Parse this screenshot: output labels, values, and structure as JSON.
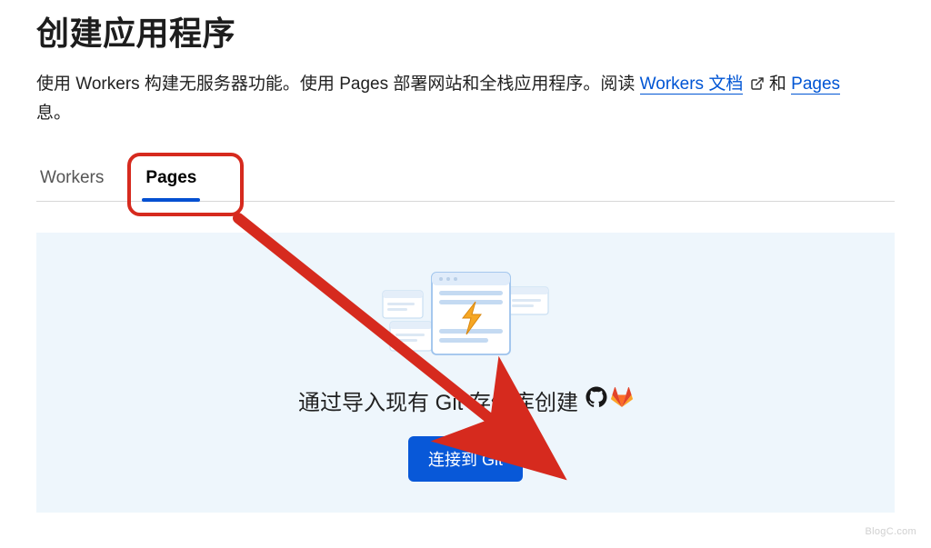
{
  "title": "创建应用程序",
  "description": {
    "part1": "使用 Workers 构建无服务器功能。使用 Pages 部署网站和全栈应用程序。阅读 ",
    "link1": "Workers 文档",
    "mid": " 和 ",
    "link2": "Pages",
    "part2": "息。"
  },
  "tabs": {
    "workers": "Workers",
    "pages": "Pages"
  },
  "hero": {
    "heading": "通过导入现有 Git 存储库创建",
    "button": "连接到 Git"
  },
  "watermark": "BlogC.com",
  "icons": {
    "external": "external-link-icon",
    "github": "github-icon",
    "gitlab": "gitlab-icon"
  }
}
